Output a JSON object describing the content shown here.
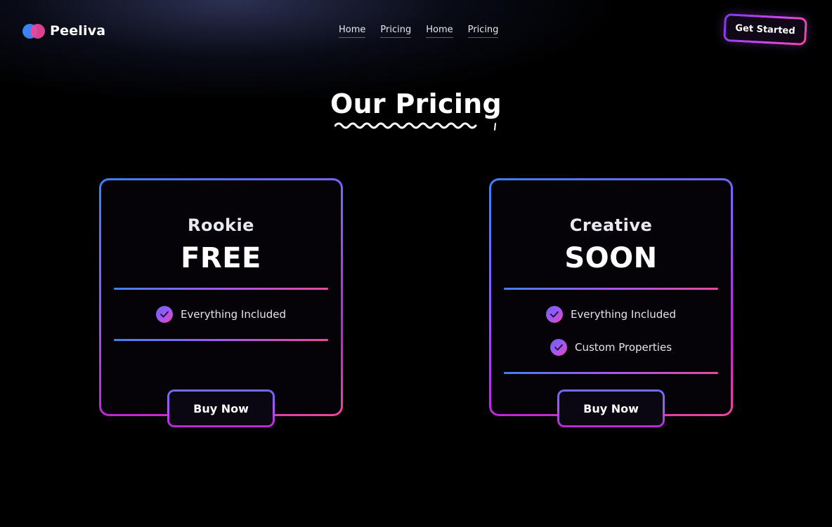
{
  "brand": {
    "name": "Peeliva",
    "logo_colors": [
      "#3b82f6",
      "#ec4899"
    ]
  },
  "nav": {
    "links": [
      "Home",
      "Pricing",
      "Home",
      "Pricing"
    ]
  },
  "header": {
    "cta_label": "Get Started"
  },
  "page": {
    "title": "Our Pricing"
  },
  "plans": [
    {
      "name": "Rookie",
      "price": "FREE",
      "features": [
        "Everything Included"
      ],
      "button_label": "Buy Now"
    },
    {
      "name": "Creative",
      "price": "SOON",
      "features": [
        "Everything Included",
        "Custom Properties"
      ],
      "button_label": "Buy Now"
    }
  ],
  "colors": {
    "background": "#000000",
    "gradient_start": "#3b82f6",
    "gradient_mid": "#a855f7",
    "gradient_end": "#ec4899"
  },
  "icons": {
    "feature": "check-circle-icon",
    "logo": "logo-circles-icon"
  }
}
